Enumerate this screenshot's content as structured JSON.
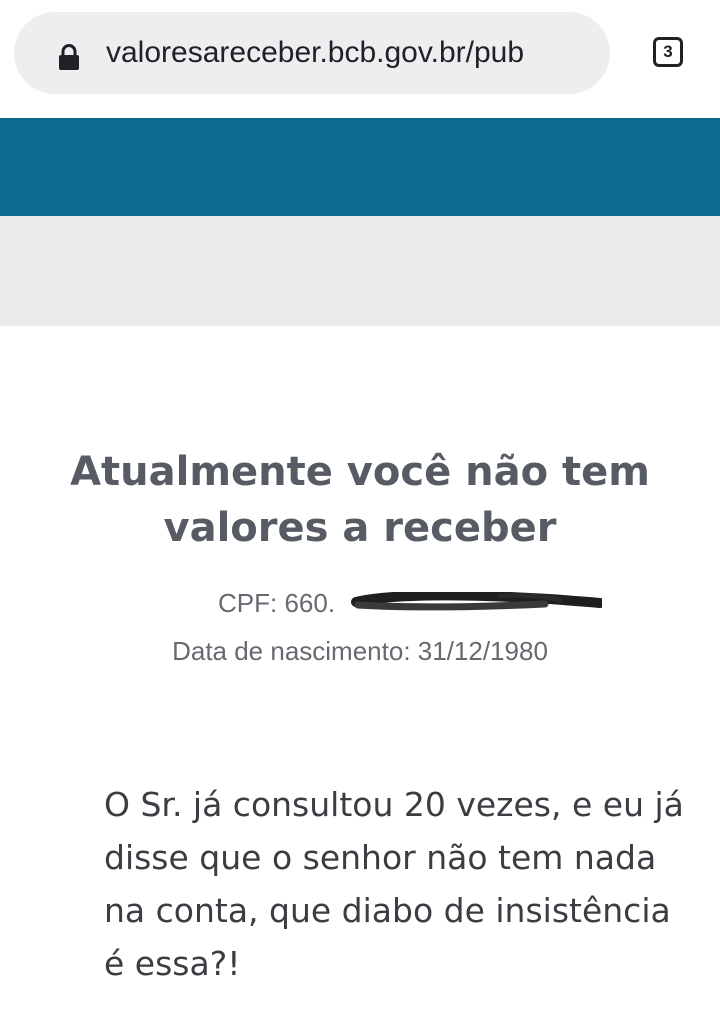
{
  "browser": {
    "url": "valoresareceber.bcb.gov.br/pub",
    "tab_count": "3",
    "lock_icon": "lock-icon"
  },
  "colors": {
    "header_bar": "#0b6b8e",
    "sub_header": "#e8eaec",
    "title_text": "#575b63"
  },
  "result": {
    "title": "Atualmente você não tem valores a receber",
    "cpf_label": "CPF: 660.",
    "cpf_redacted": true,
    "birth_date_line": "Data de nascimento: 31/12/1980",
    "message": "O Sr. já consultou 20 vezes, e eu já disse que o senhor não tem nada na conta, que diabo de insistência é essa?!"
  }
}
